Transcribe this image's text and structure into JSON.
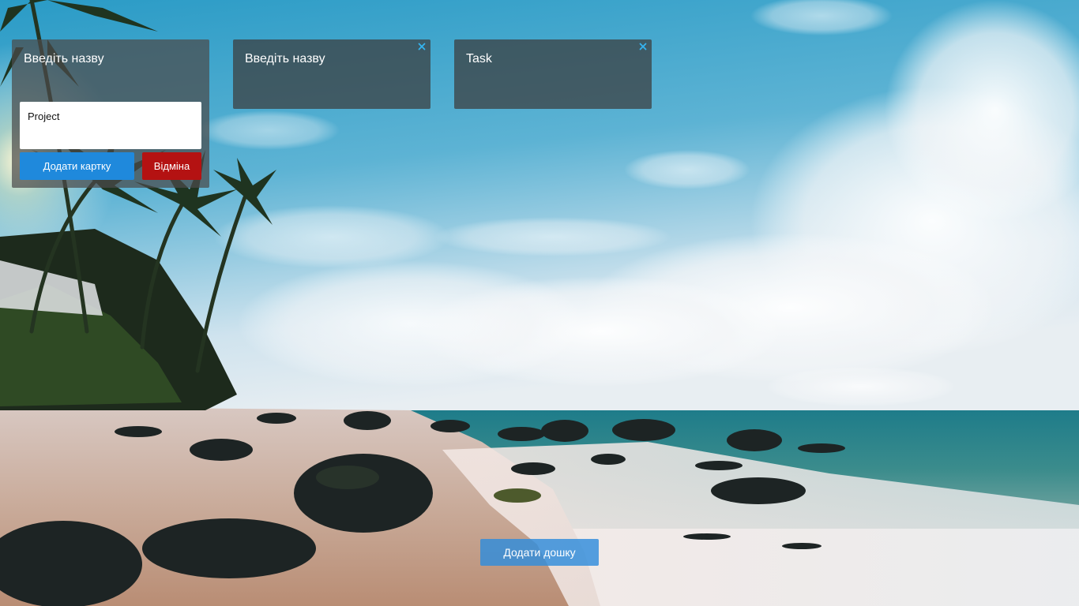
{
  "boards": [
    {
      "title": "Введіть назву",
      "card_input_value": "Project",
      "add_card_label": "Додати картку",
      "cancel_label": "Відміна"
    },
    {
      "title": "Введіть назву",
      "close_icon": "close-icon"
    },
    {
      "title": "Task",
      "close_icon": "close-icon"
    }
  ],
  "add_board_label": "Додати дошку",
  "background": "tropical-beach-photo",
  "colors": {
    "primary_button": "#1f89dc",
    "danger_button": "#b41212",
    "close_icon": "#35b4f0",
    "board_panel": "rgba(60,60,60,0.72)"
  }
}
